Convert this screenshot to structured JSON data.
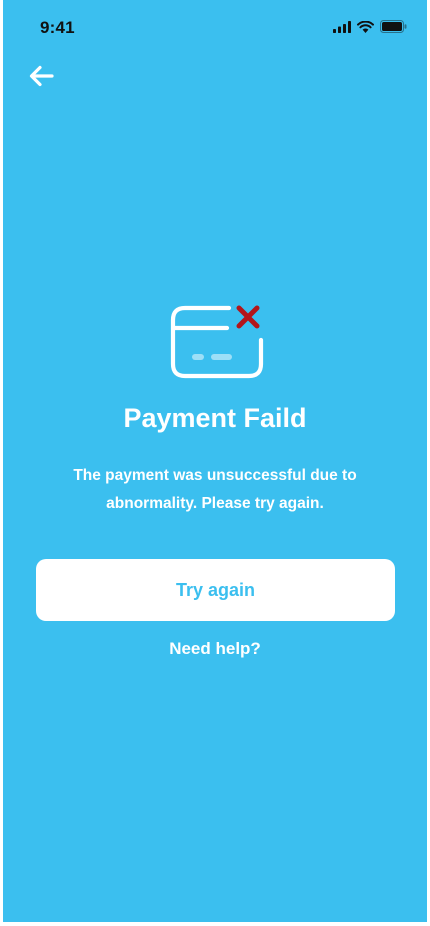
{
  "status_bar": {
    "time": "9:41",
    "icons": [
      "cellular-signal-icon",
      "wifi-icon",
      "battery-icon"
    ]
  },
  "header": {
    "back_icon": "arrow-left-icon"
  },
  "illustration": {
    "icon": "credit-card-failed-icon",
    "error_mark_color": "#b3151a"
  },
  "content": {
    "title": "Payment Faild",
    "message": "The payment was unsuccessful due to abnormality. Please try again."
  },
  "actions": {
    "try_again_label": "Try again",
    "help_label": "Need help?"
  },
  "colors": {
    "background": "#3bbfef",
    "button_background": "#ffffff",
    "button_text": "#3bbfef",
    "text": "#ffffff"
  }
}
